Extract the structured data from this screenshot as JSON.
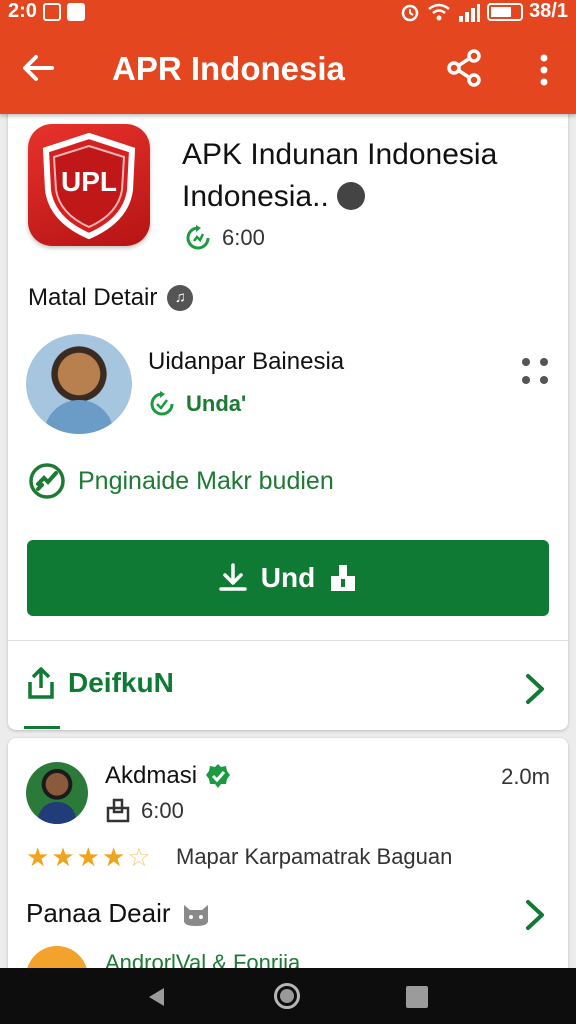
{
  "status_bar": {
    "time": "2:0",
    "battery": "38/1"
  },
  "app_bar": {
    "title": "APR Indonesia",
    "back_icon": "arrow-left-icon",
    "share_icon": "share-icon",
    "menu_icon": "more-vert-icon"
  },
  "app": {
    "icon_text": "UPL",
    "name": "APK Indunan Indonesia Indonesia..",
    "time": "6:00",
    "colors": {
      "icon": "#e4322b",
      "accent": "#0e7a33",
      "app_bar": "#e4461f"
    }
  },
  "details": {
    "title": "Matal Detair"
  },
  "developer": {
    "name": "Uidanpar Bainesia",
    "status": "Unda'"
  },
  "verified": {
    "text": "Pnginaide Makr budien"
  },
  "install_button": {
    "label": "Und"
  },
  "share_row": {
    "label": "DeifkuN"
  },
  "review": {
    "author": "Akdmasi",
    "age": "2.0m",
    "time": "6:00",
    "rating": 4.5,
    "rating_max": 5,
    "text": "Mapar Karpamatrak Baguan"
  },
  "more": {
    "title": "Panaa Deair",
    "next_item": "AndrorlVal & Fonrija"
  }
}
